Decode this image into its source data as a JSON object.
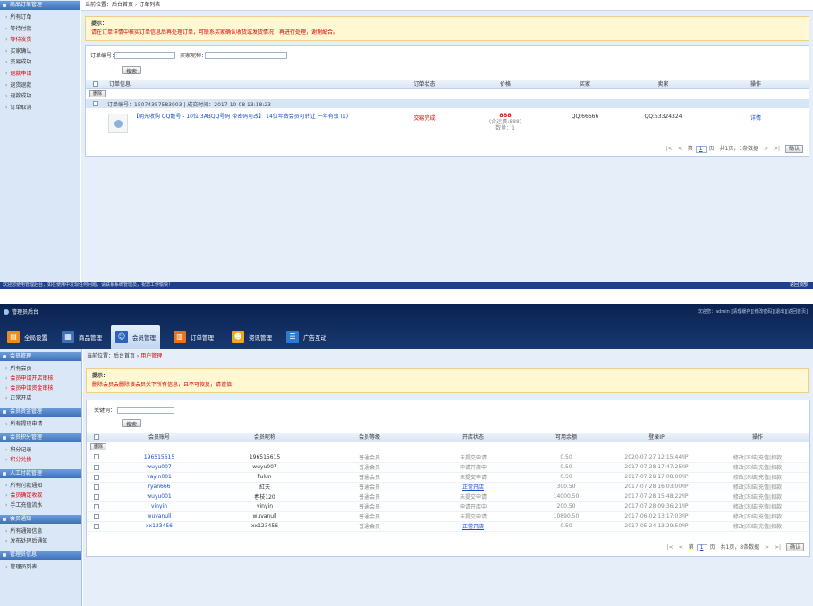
{
  "top": {
    "sidebar": {
      "title": "商品订单管理",
      "items": [
        {
          "label": "所有订单",
          "highlight": false
        },
        {
          "label": "等待付款",
          "highlight": false
        },
        {
          "label": "等待发货",
          "highlight": true
        },
        {
          "label": "买家确认",
          "highlight": false
        },
        {
          "label": "交易成功",
          "highlight": false
        },
        {
          "label": "退款申请",
          "highlight": true
        },
        {
          "label": "退货退款",
          "highlight": false
        },
        {
          "label": "退款成功",
          "highlight": false
        },
        {
          "label": "订单取消",
          "highlight": false
        }
      ]
    },
    "breadcrumb": {
      "prefix": "当前位置：后台首页 › ",
      "current": "订单列表"
    },
    "notice": {
      "title": "提示：",
      "text": "请在订单详情中核实订单信息后再处理订单，可联系买家确认收货或发货情况，再进行处理，谢谢配合。"
    },
    "search": {
      "order_no_label": "订单编号：",
      "order_no_value": "",
      "buyer_label": "买家昵称：",
      "buyer_value": "",
      "button": "搜索"
    },
    "table": {
      "headers": {
        "info": "订单信息",
        "status": "订单状态",
        "price": "价格",
        "buyer": "买家",
        "seller": "卖家",
        "ops": "操作"
      },
      "delete_button": "删除",
      "order": {
        "number_line": "订单编号：15074357583903 | 成交时间：2017-10-08 13:18:23",
        "title": "【明光收购 QQ靓号 - 10位 3ABQQ号码 带密码可改】 14位年费会员可转让 一年有效 (1)",
        "status": "交易完成",
        "price": "888",
        "price_note": "(含运费:888)",
        "quantity": "数量：1",
        "buyer": "QQ:66666",
        "seller": "QQ:53324324",
        "action": "详情"
      }
    },
    "pagination": {
      "first": "|<",
      "prev": "<",
      "page_prefix": "第",
      "page_value": "1",
      "page_suffix": "页",
      "summary": "共1页，1条数据",
      "next": ">",
      "last": ">|",
      "confirm": "确认"
    },
    "footer": {
      "text": "欢迎您使用管理后台，如在使用中发现任何问题，请联系系统管理员，祝您工作愉快！",
      "back_top": "返回顶部"
    }
  },
  "bottom": {
    "header": {
      "logo": "管理员后台",
      "greeting": "欢迎您：admin",
      "links": [
        "[清理缓存]",
        "[修改密码]",
        "[退出]",
        "[返回首页]"
      ],
      "tabs": [
        {
          "label": "全局设置",
          "icon": "settings-icon",
          "color": "#f08a1c",
          "glyph": "▤"
        },
        {
          "label": "商品管理",
          "icon": "grid-icon",
          "color": "#3f6fb6",
          "glyph": "▦"
        },
        {
          "label": "会员管理",
          "icon": "user-icon",
          "color": "#2a63b8",
          "glyph": "☺"
        },
        {
          "label": "订单管理",
          "icon": "order-icon",
          "color": "#e8741a",
          "glyph": "▥"
        },
        {
          "label": "资讯管理",
          "icon": "news-icon",
          "color": "#f0a81a",
          "glyph": "☻"
        },
        {
          "label": "广告互动",
          "icon": "ad-icon",
          "color": "#2f79cf",
          "glyph": "☰"
        }
      ],
      "selected_tab": "会员管理"
    },
    "sidebar": {
      "sections": [
        {
          "title": "会员管理",
          "items": [
            {
              "label": "所有会员",
              "highlight": false
            },
            {
              "label": "会员申请开店审核",
              "highlight": true
            },
            {
              "label": "会员申请资金审核",
              "highlight": true
            },
            {
              "label": "正常开店",
              "highlight": false
            }
          ]
        },
        {
          "title": "会员资金管理",
          "items": [
            {
              "label": "所有提现申请",
              "highlight": false
            }
          ]
        },
        {
          "title": "会员积分管理",
          "items": [
            {
              "label": "积分记录",
              "highlight": false
            },
            {
              "label": "积分兑换",
              "highlight": true
            }
          ]
        },
        {
          "title": "人工付款管理",
          "items": [
            {
              "label": "所有付款通知",
              "highlight": false
            },
            {
              "label": "会员确定收款",
              "highlight": true
            },
            {
              "label": "手工充值流水",
              "highlight": false
            }
          ]
        },
        {
          "title": "会员通知",
          "items": [
            {
              "label": "所有通知信息",
              "highlight": false
            },
            {
              "label": "发布处理后通知",
              "highlight": false
            }
          ]
        },
        {
          "title": "管理员信息",
          "items": [
            {
              "label": "管理员列表",
              "highlight": false
            }
          ]
        }
      ]
    },
    "breadcrumb": {
      "prefix": "当前位置：后台首页 › ",
      "current": "用户管理"
    },
    "notice": {
      "title": "提示：",
      "text": "删除会员会删除该会员关下所有信息，且不可恢复，请谨慎！"
    },
    "search": {
      "keyword_label": "关键词：",
      "keyword_value": "",
      "button": "搜索"
    },
    "table": {
      "headers": [
        "会员账号",
        "会员昵称",
        "会员等级",
        "开店状态",
        "可用余额",
        "登录IP",
        "操作"
      ],
      "delete_button": "删除",
      "row_actions": [
        "修改",
        "冻结",
        "充值",
        "扣款"
      ],
      "action_separator": "|",
      "rows": [
        {
          "account": "196515615",
          "nick": "196515615",
          "level": "普通会员",
          "status": "未提交申请",
          "status_open": false,
          "balance": "0.50",
          "login": "2020-07-27 12:15:44/IP"
        },
        {
          "account": "wuyu007",
          "nick": "wuyu007",
          "level": "普通会员",
          "status": "申请开店中",
          "status_open": false,
          "balance": "0.50",
          "login": "2017-07-28 17:47:25/IP"
        },
        {
          "account": "vayin001",
          "nick": "fulun",
          "level": "普通会员",
          "status": "未提交申请",
          "status_open": false,
          "balance": "0.50",
          "login": "2017-07-28 17:08:00/IP"
        },
        {
          "account": "ryan666",
          "nick": "紅天",
          "level": "普通会员",
          "status": "正常开店",
          "status_open": true,
          "balance": "300.50",
          "login": "2017-07-28 16:03:00/IP"
        },
        {
          "account": "wuyu001",
          "nick": "春枝120",
          "level": "普通会员",
          "status": "未提交申请",
          "status_open": false,
          "balance": "14000.50",
          "login": "2017-07-28 15:48:22/IP"
        },
        {
          "account": "vinyin",
          "nick": "vinyin",
          "level": "普通会员",
          "status": "申请开店中",
          "status_open": false,
          "balance": "200.50",
          "login": "2017-07-28 09:36:21/IP"
        },
        {
          "account": "wuvanull",
          "nick": "wuvanull",
          "level": "普通会员",
          "status": "未提交申请",
          "status_open": false,
          "balance": "10890.50",
          "login": "2017-06-02 13:17:03/IP"
        },
        {
          "account": "xx123456",
          "nick": "xx123456",
          "level": "普通会员",
          "status": "正常开店",
          "status_open": true,
          "balance": "0.50",
          "login": "2017-05-24 13:29:50/IP"
        }
      ]
    },
    "pagination": {
      "first": "|<",
      "prev": "<",
      "page_prefix": "第",
      "page_value": "1",
      "page_suffix": "页",
      "summary": "共1页，8条数据",
      "next": ">",
      "last": ">|",
      "confirm": "确认"
    }
  }
}
